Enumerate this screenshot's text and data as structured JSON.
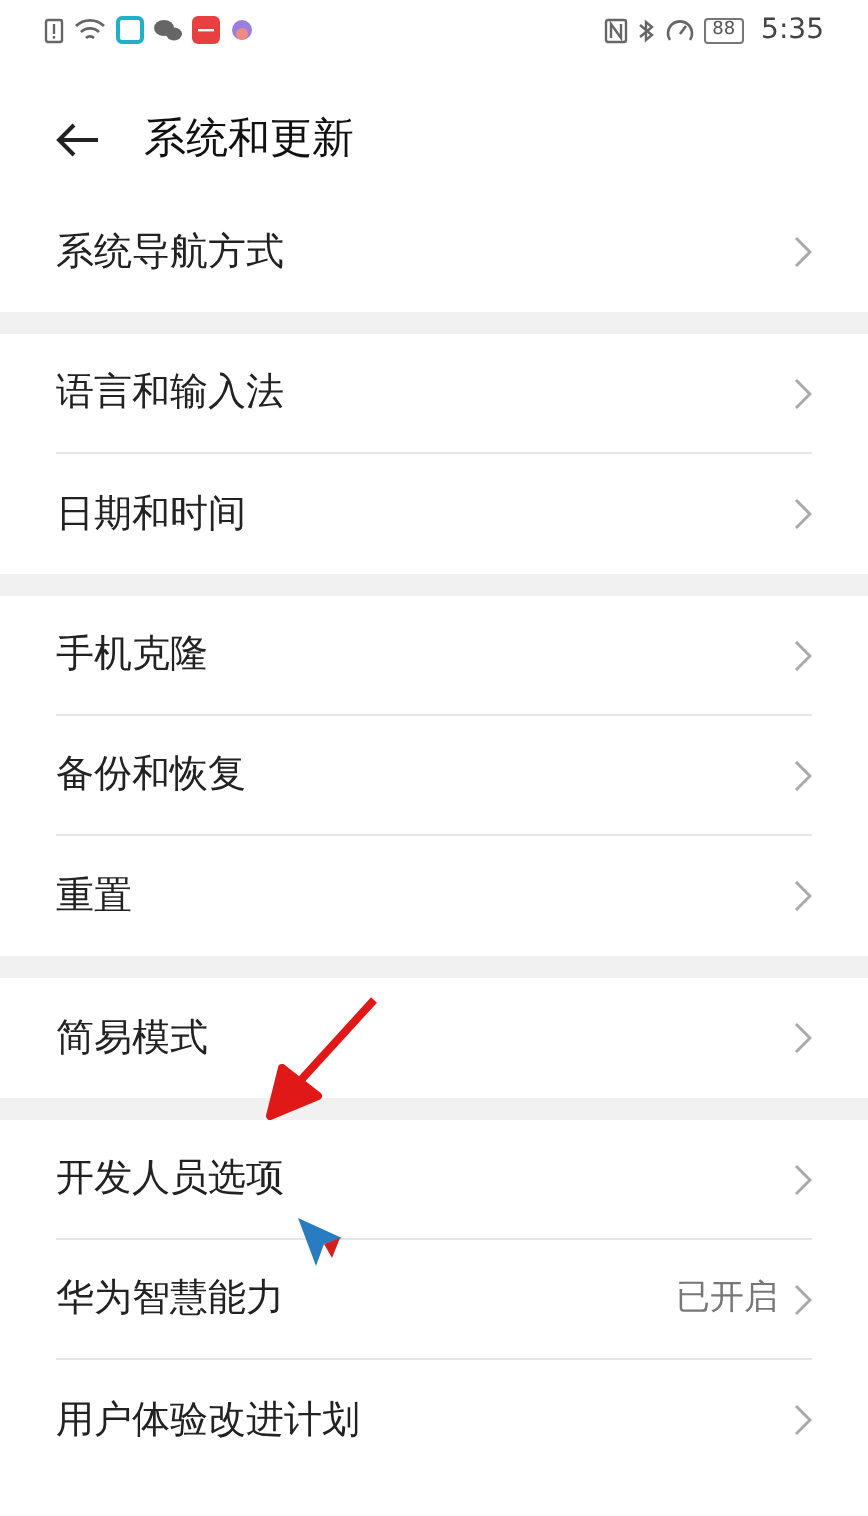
{
  "status_bar": {
    "battery": "88",
    "time": "5:35"
  },
  "header": {
    "title": "系统和更新"
  },
  "groups": [
    {
      "items": [
        {
          "label": "系统导航方式"
        }
      ]
    },
    {
      "items": [
        {
          "label": "语言和输入法"
        },
        {
          "label": "日期和时间"
        }
      ]
    },
    {
      "items": [
        {
          "label": "手机克隆"
        },
        {
          "label": "备份和恢复"
        },
        {
          "label": "重置"
        }
      ]
    },
    {
      "items": [
        {
          "label": "简易模式"
        }
      ]
    },
    {
      "items": [
        {
          "label": "开发人员选项"
        },
        {
          "label": "华为智慧能力",
          "value": "已开启"
        },
        {
          "label": "用户体验改进计划"
        }
      ]
    }
  ]
}
